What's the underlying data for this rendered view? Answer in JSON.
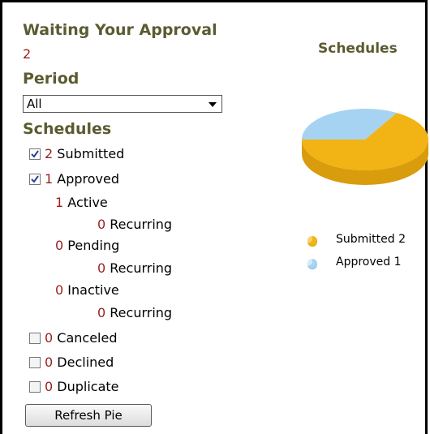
{
  "waiting": {
    "heading": "Waiting Your Approval",
    "count": "2"
  },
  "period": {
    "heading": "Period",
    "selected": "All"
  },
  "schedules": {
    "heading": "Schedules",
    "submitted": {
      "num": "2",
      "label": "Submitted",
      "checked": true
    },
    "approved": {
      "num": "1",
      "label": "Approved",
      "checked": true
    },
    "active": {
      "num": "1",
      "label": "Active"
    },
    "active_recurring": {
      "num": "0",
      "label": "Recurring"
    },
    "pending": {
      "num": "0",
      "label": "Pending"
    },
    "pending_recurring": {
      "num": "0",
      "label": "Recurring"
    },
    "inactive": {
      "num": "0",
      "label": "Inactive"
    },
    "inactive_recurring": {
      "num": "0",
      "label": "Recurring"
    },
    "canceled": {
      "num": "0",
      "label": "Canceled",
      "checked": false
    },
    "declined": {
      "num": "0",
      "label": "Declined",
      "checked": false
    },
    "duplicate": {
      "num": "0",
      "label": "Duplicate",
      "checked": false
    }
  },
  "refresh_button": "Refresh Pie",
  "colors": {
    "submitted": "#f2b314",
    "approved": "#a7d3f2",
    "accent": "#9a1f1f",
    "heading": "#5b5b32"
  },
  "chart_data": {
    "type": "pie",
    "title": "Schedules",
    "slices": [
      {
        "label": "Submitted",
        "value": 2
      },
      {
        "label": "Approved",
        "value": 1
      }
    ],
    "legend": [
      "Submitted 2",
      "Approved 1"
    ],
    "legend_position": "below"
  }
}
